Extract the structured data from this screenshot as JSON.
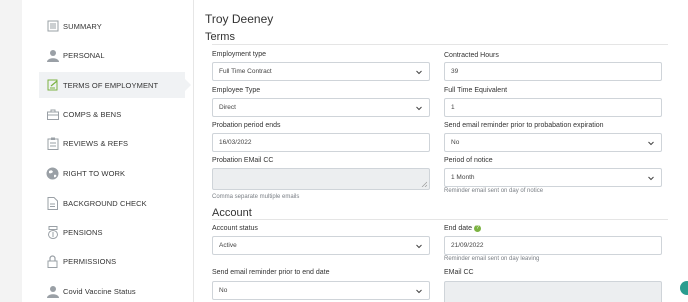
{
  "sidebar": {
    "items": [
      {
        "label": "SUMMARY",
        "icon": "document-icon"
      },
      {
        "label": "PERSONAL",
        "icon": "person-icon"
      },
      {
        "label": "TERMS OF EMPLOYMENT",
        "icon": "contract-icon",
        "active": true
      },
      {
        "label": "COMPS & BENS",
        "icon": "briefcase-icon"
      },
      {
        "label": "REVIEWS & REFS",
        "icon": "clipboard-icon"
      },
      {
        "label": "RIGHT TO WORK",
        "icon": "globe-icon"
      },
      {
        "label": "BACKGROUND CHECK",
        "icon": "document-check-icon"
      },
      {
        "label": "PENSIONS",
        "icon": "piggy-bank-icon"
      },
      {
        "label": "PERMISSIONS",
        "icon": "lock-icon"
      },
      {
        "label": "Covid Vaccine Status",
        "icon": "person-icon"
      }
    ]
  },
  "header": {
    "employee_name": "Troy Deeney"
  },
  "terms": {
    "title": "Terms",
    "employment_type": {
      "label": "Employment type",
      "value": "Full Time Contract"
    },
    "contracted_hours": {
      "label": "Contracted Hours",
      "value": "39"
    },
    "employee_type": {
      "label": "Employee Type",
      "value": "Direct"
    },
    "fte": {
      "label": "Full Time Equivalent",
      "value": "1"
    },
    "probation_ends": {
      "label": "Probation period ends",
      "value": "16/03/2022"
    },
    "probation_reminder": {
      "label": "Send email reminder prior to probabation expiration",
      "value": "No"
    },
    "probation_email_cc": {
      "label": "Probation EMail CC",
      "value": "",
      "help": "Comma separate multiple emails"
    },
    "notice_period": {
      "label": "Period of notice",
      "value": "1 Month",
      "help": "Reminder email sent on day of notice"
    }
  },
  "account": {
    "title": "Account",
    "status": {
      "label": "Account status",
      "value": "Active"
    },
    "end_date": {
      "label": "End date",
      "value": "21/09/2022",
      "help": "Reminder email sent on day leaving",
      "info_glyph": "?"
    },
    "end_reminder": {
      "label": "Send email reminder prior to end date",
      "value": "No"
    },
    "email_cc": {
      "label": "EMail CC",
      "value": ""
    }
  },
  "colors": {
    "accent_green": "#7cb342",
    "active_bg": "#f0f2f4",
    "icon_gray": "#9aa0a6"
  }
}
